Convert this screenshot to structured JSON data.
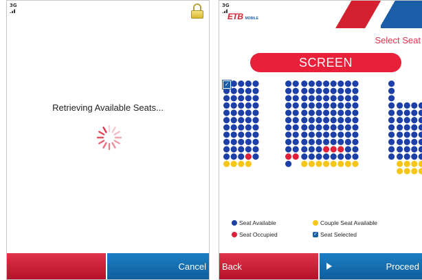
{
  "left_screen": {
    "signal_label": "3G",
    "status_message": "Retrieving Available Seats...",
    "softkeys": {
      "left": "",
      "right": "Cancel"
    }
  },
  "right_screen": {
    "signal_label": "3G",
    "logo": {
      "brand": "ETB",
      "sub": "MOBILE"
    },
    "select_seat_label": "Select Seat",
    "screen_label": "SCREEN",
    "legend": {
      "available": "Seat Available",
      "couple": "Couple Seat Available",
      "occupied": "Seat Occupied",
      "selected": "Seat Selected"
    },
    "softkeys": {
      "left": "Back",
      "right": "Proceed"
    },
    "seat_blocks": [
      {
        "rows": [
          "AAAAA",
          "AAAAA",
          "AAAAA",
          "AAAAA",
          "AAAAA",
          "AAAAA",
          "AAAAA",
          "AAAAA",
          "AAAAA",
          "AAAAA",
          "AAAOA",
          "CCCC"
        ]
      },
      {
        "rows": [
          "AA",
          "AA",
          "AA",
          "AA",
          "AA",
          "AA",
          "AA",
          "AA",
          "AA",
          "AA",
          "OO",
          "A"
        ]
      },
      {
        "rows": [
          "AAAAAAAA",
          "AAAAAAAA",
          "AAAAAAAA",
          "AAAAAAAA",
          "AAAAAAAA",
          "AAAAAAAA",
          "AAAAAAAA",
          "AAAAAAAA",
          "AAAAAAAA",
          "AAAOOOAA",
          "AAAAAAAA",
          "CCCCCCCC"
        ]
      },
      {
        "rows": [
          "A",
          "A",
          "A",
          "A",
          "A",
          "A",
          "A",
          "A",
          "A",
          "A",
          "A",
          ""
        ]
      },
      {
        "rows": [
          "",
          "",
          "",
          "AAAA",
          "AAAA",
          "AAAA",
          "AAAA",
          "AAAA",
          "AAAA",
          "AAAA",
          "AAAA",
          "CCCC",
          "CCCC"
        ]
      }
    ]
  },
  "colors": {
    "available": "#1d3fa8",
    "occupied": "#e0203a",
    "couple": "#f5c518",
    "selected": "#1a5ea8",
    "softkey_red": "#c8213a",
    "softkey_blue": "#1470b4"
  },
  "icons": [
    "signal-3g-icon",
    "lock-icon",
    "loading-spinner-icon",
    "etb-mobile-logo",
    "seat-selected-check-icon",
    "play-icon"
  ]
}
